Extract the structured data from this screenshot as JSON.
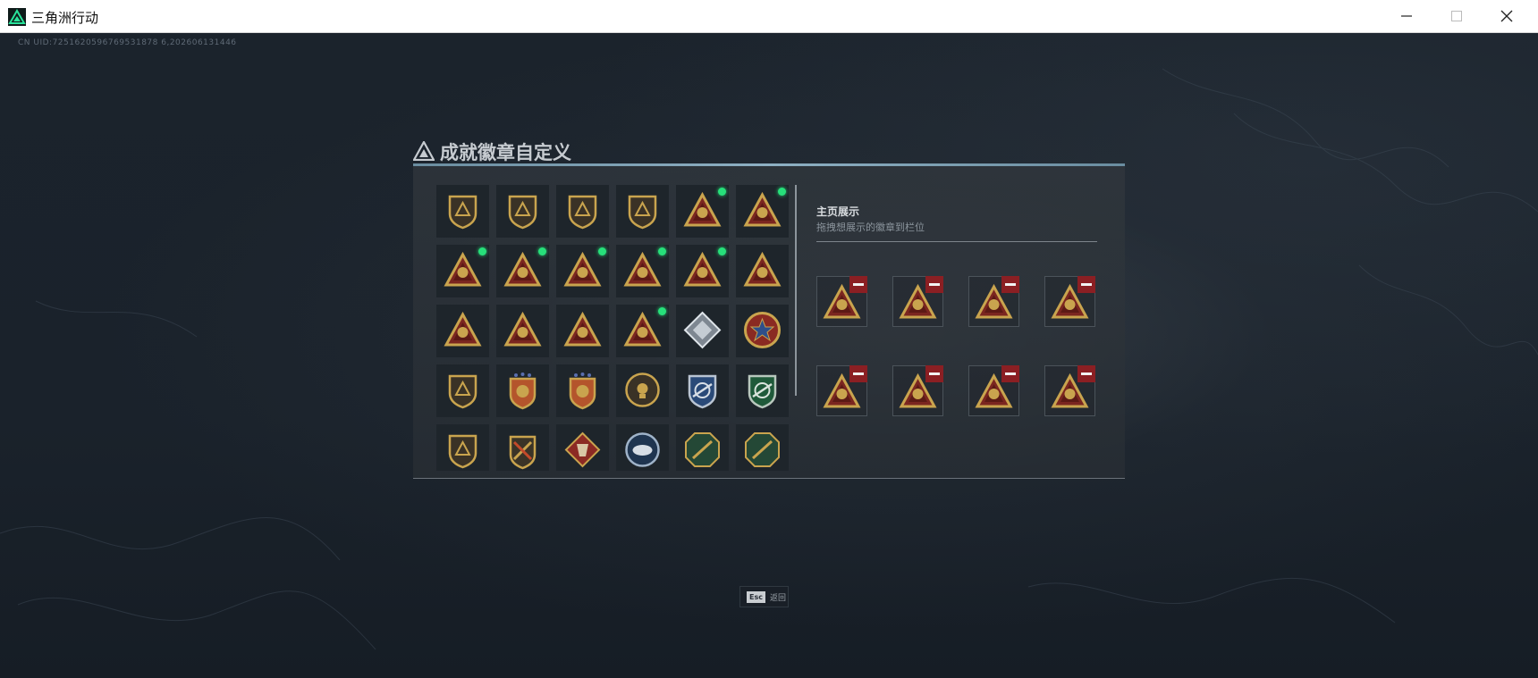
{
  "window": {
    "title": "三角洲行动",
    "controls": [
      "minimize",
      "maximize",
      "close"
    ]
  },
  "uid_text": "CN UID:7251620596769531878 6,202606131446",
  "dialog": {
    "title": "成就徽章自定义"
  },
  "showcase": {
    "title": "主页展示",
    "subtitle": "拖拽想展示的徽章到栏位"
  },
  "badge_grid": {
    "columns": 6,
    "visible_rows": 5,
    "badges": [
      {
        "icon": "shield-triangle-badge-icon",
        "style": "gold-shield",
        "new": false
      },
      {
        "icon": "helicopter-badge-icon",
        "style": "gold-shield",
        "new": false
      },
      {
        "icon": "diamond-emblem-badge-icon",
        "style": "gold-shield",
        "new": false
      },
      {
        "icon": "arrow-emblem-badge-icon",
        "style": "gold-shield",
        "new": false
      },
      {
        "icon": "skull-triangle-badge-icon",
        "style": "red-triangle",
        "new": true
      },
      {
        "icon": "crossbones-triangle-badge-icon",
        "style": "red-triangle",
        "new": true
      },
      {
        "icon": "backpack-triangle-badge-icon",
        "style": "red-triangle",
        "new": true
      },
      {
        "icon": "crate-triangle-badge-icon",
        "style": "red-triangle",
        "new": true
      },
      {
        "icon": "vest-triangle-badge-icon",
        "style": "red-triangle",
        "new": true
      },
      {
        "icon": "document-triangle-badge-icon",
        "style": "red-triangle",
        "new": true
      },
      {
        "icon": "robot-triangle-badge-icon",
        "style": "red-triangle",
        "new": true
      },
      {
        "icon": "helmet-triangle-badge-icon",
        "style": "red-triangle",
        "new": false
      },
      {
        "icon": "number-one-triangle-badge-icon",
        "style": "red-triangle",
        "new": false
      },
      {
        "icon": "box-triangle-badge-icon",
        "style": "red-triangle",
        "new": false
      },
      {
        "icon": "soldier-triangle-badge-icon",
        "style": "red-triangle",
        "new": false
      },
      {
        "icon": "rocket-triangle-badge-icon",
        "style": "red-triangle",
        "new": true
      },
      {
        "icon": "cube-diamond-badge-icon",
        "style": "silver-diamond",
        "new": false
      },
      {
        "icon": "star-medal-badge-icon",
        "style": "red-medal",
        "new": false
      },
      {
        "icon": "fist-shield-badge-icon",
        "style": "gold-shield",
        "new": false
      },
      {
        "icon": "crest-stars-badge-icon",
        "style": "orange-crest",
        "new": false
      },
      {
        "icon": "crest-stars-2-badge-icon",
        "style": "orange-crest",
        "new": false
      },
      {
        "icon": "skull-round-badge-icon",
        "style": "gold-round",
        "new": false
      },
      {
        "icon": "wing-shield-badge-icon",
        "style": "blue-shield",
        "new": false
      },
      {
        "icon": "green-shield-badge-icon",
        "style": "green-shield",
        "new": false
      },
      {
        "icon": "compass-shield-badge-icon",
        "style": "gold-shield",
        "new": false
      },
      {
        "icon": "sword-crest-badge-icon",
        "style": "gold-crest",
        "new": false
      },
      {
        "icon": "wolf-diamond-badge-icon",
        "style": "red-diamond",
        "new": false
      },
      {
        "icon": "eagle-round-badge-icon",
        "style": "blue-round",
        "new": false
      },
      {
        "icon": "plane-octagon-badge-icon",
        "style": "green-octagon",
        "new": false
      },
      {
        "icon": "gun-octagon-badge-icon",
        "style": "green-octagon",
        "new": false
      }
    ]
  },
  "showcase_slots": [
    {
      "icon": "skull-triangle-badge-icon",
      "style": "red-triangle"
    },
    {
      "icon": "crossbones-triangle-badge-icon",
      "style": "red-triangle"
    },
    {
      "icon": "backpack-triangle-badge-icon",
      "style": "red-triangle"
    },
    {
      "icon": "crate-triangle-badge-icon",
      "style": "red-triangle"
    },
    {
      "icon": "vest-triangle-badge-icon",
      "style": "red-triangle"
    },
    {
      "icon": "document-triangle-badge-icon",
      "style": "red-triangle"
    },
    {
      "icon": "robot-triangle-badge-icon",
      "style": "red-triangle"
    },
    {
      "icon": "rocket-triangle-badge-icon",
      "style": "red-triangle"
    }
  ],
  "footer_hint": {
    "key": "Esc",
    "label": "返回"
  },
  "colors": {
    "gold": "#c9a44e",
    "red": "#7b2620",
    "new_dot": "#27e07a",
    "remove": "#8b1f23"
  }
}
